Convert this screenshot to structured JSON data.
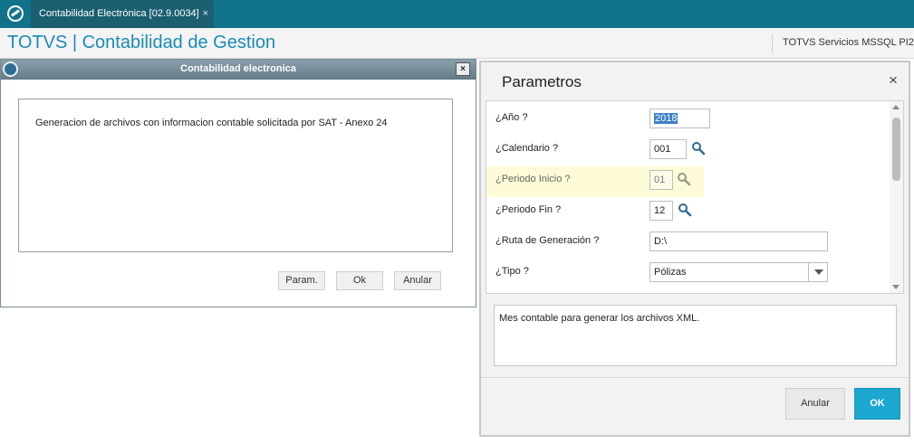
{
  "topbar": {
    "tab_label": "Contabilidad Electrónica [02.9.0034]",
    "tab_close": "×"
  },
  "header": {
    "title": "TOTVS | Contabilidad de Gestion",
    "server": "TOTVS Servicios MSSQL PI2_"
  },
  "dialog": {
    "title": "Contabilidad electronica",
    "close": "×",
    "info": "Generacion de archivos con informacion contable solicitada por SAT - Anexo 24",
    "buttons": {
      "param": "Param.",
      "ok": "Ok",
      "anular": "Anular"
    }
  },
  "panel": {
    "title": "Parametros",
    "close": "×",
    "params": [
      {
        "label": "¿Año ?",
        "value": "2018"
      },
      {
        "label": "¿Calendario ?",
        "value": "001"
      },
      {
        "label": "¿Periodo Inicio ?",
        "value": "01"
      },
      {
        "label": "¿Periodo Fin ?",
        "value": "12"
      },
      {
        "label": "¿Ruta de Generación ?",
        "value": "D:\\"
      },
      {
        "label": "¿Tipo ?",
        "value": "Pólizas"
      }
    ],
    "help_text": "Mes contable para generar los archivos XML.",
    "buttons": {
      "anular": "Anular",
      "ok": "OK"
    }
  },
  "colors": {
    "topbar": "#11738a",
    "accent": "#1ba7cf",
    "title": "#1a8bb4",
    "highlight": "#fefbd8"
  },
  "icons": [
    "app-logo-icon",
    "dialog-app-icon",
    "search-icon",
    "chevron-down-icon",
    "close-icon"
  ]
}
